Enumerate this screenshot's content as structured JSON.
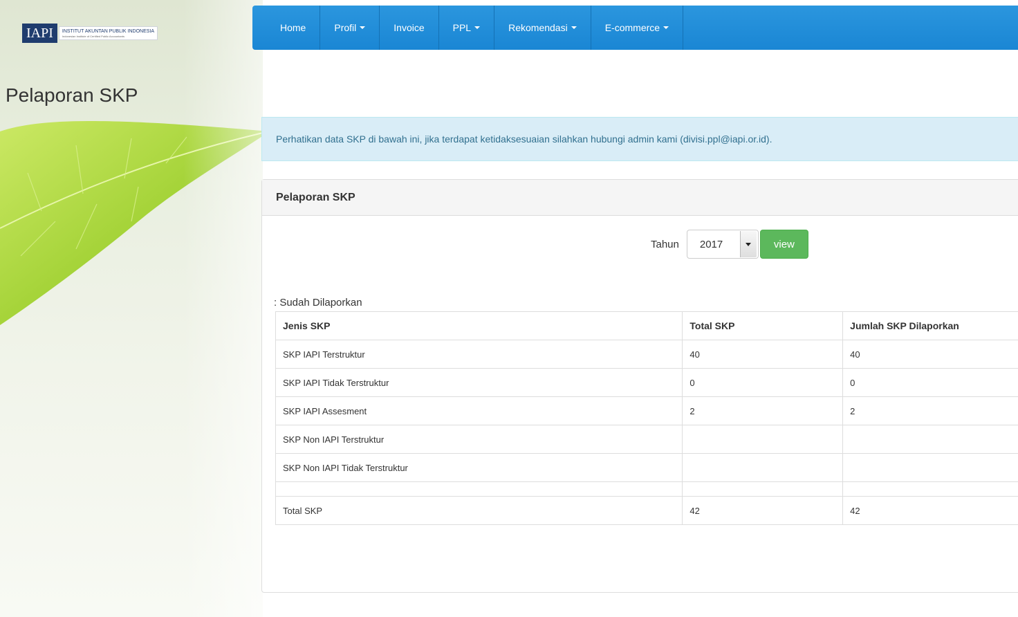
{
  "logo": {
    "mark": "IAPI",
    "line1": "INSTITUT AKUNTAN PUBLIK INDONESIA",
    "line2": "Indonesian Institute of Certified Public Accountants"
  },
  "nav": {
    "items": [
      {
        "label": "Home",
        "dropdown": false
      },
      {
        "label": "Profil",
        "dropdown": true
      },
      {
        "label": "Invoice",
        "dropdown": false
      },
      {
        "label": "PPL",
        "dropdown": true
      },
      {
        "label": "Rekomendasi",
        "dropdown": true
      },
      {
        "label": "E-commerce",
        "dropdown": true
      }
    ]
  },
  "page": {
    "title": "Pelaporan SKP"
  },
  "alert": {
    "text": "Perhatikan data SKP di bawah ini, jika terdapat ketidaksesuaian silahkan hubungi admin kami (divisi.ppl@iapi.or.id)."
  },
  "panel": {
    "title": "Pelaporan SKP",
    "filter": {
      "label": "Tahun",
      "year": "2017",
      "button": "view"
    },
    "status": ": Sudah Dilaporkan",
    "table": {
      "headers": [
        "Jenis SKP",
        "Total SKP",
        "Jumlah SKP Dilaporkan"
      ],
      "rows": [
        [
          "SKP IAPI Terstruktur",
          "40",
          "40"
        ],
        [
          "SKP IAPI Tidak Terstruktur",
          "0",
          "0"
        ],
        [
          "SKP IAPI Assesment",
          "2",
          "2"
        ],
        [
          "SKP Non IAPI Terstruktur",
          "",
          ""
        ],
        [
          "SKP Non IAPI Tidak Terstruktur",
          "",
          ""
        ]
      ],
      "total": [
        "Total SKP",
        "42",
        "42"
      ]
    }
  },
  "colors": {
    "navbar": "#1a86d4",
    "alert_bg": "#d9edf7",
    "button_green": "#5cb85c"
  }
}
